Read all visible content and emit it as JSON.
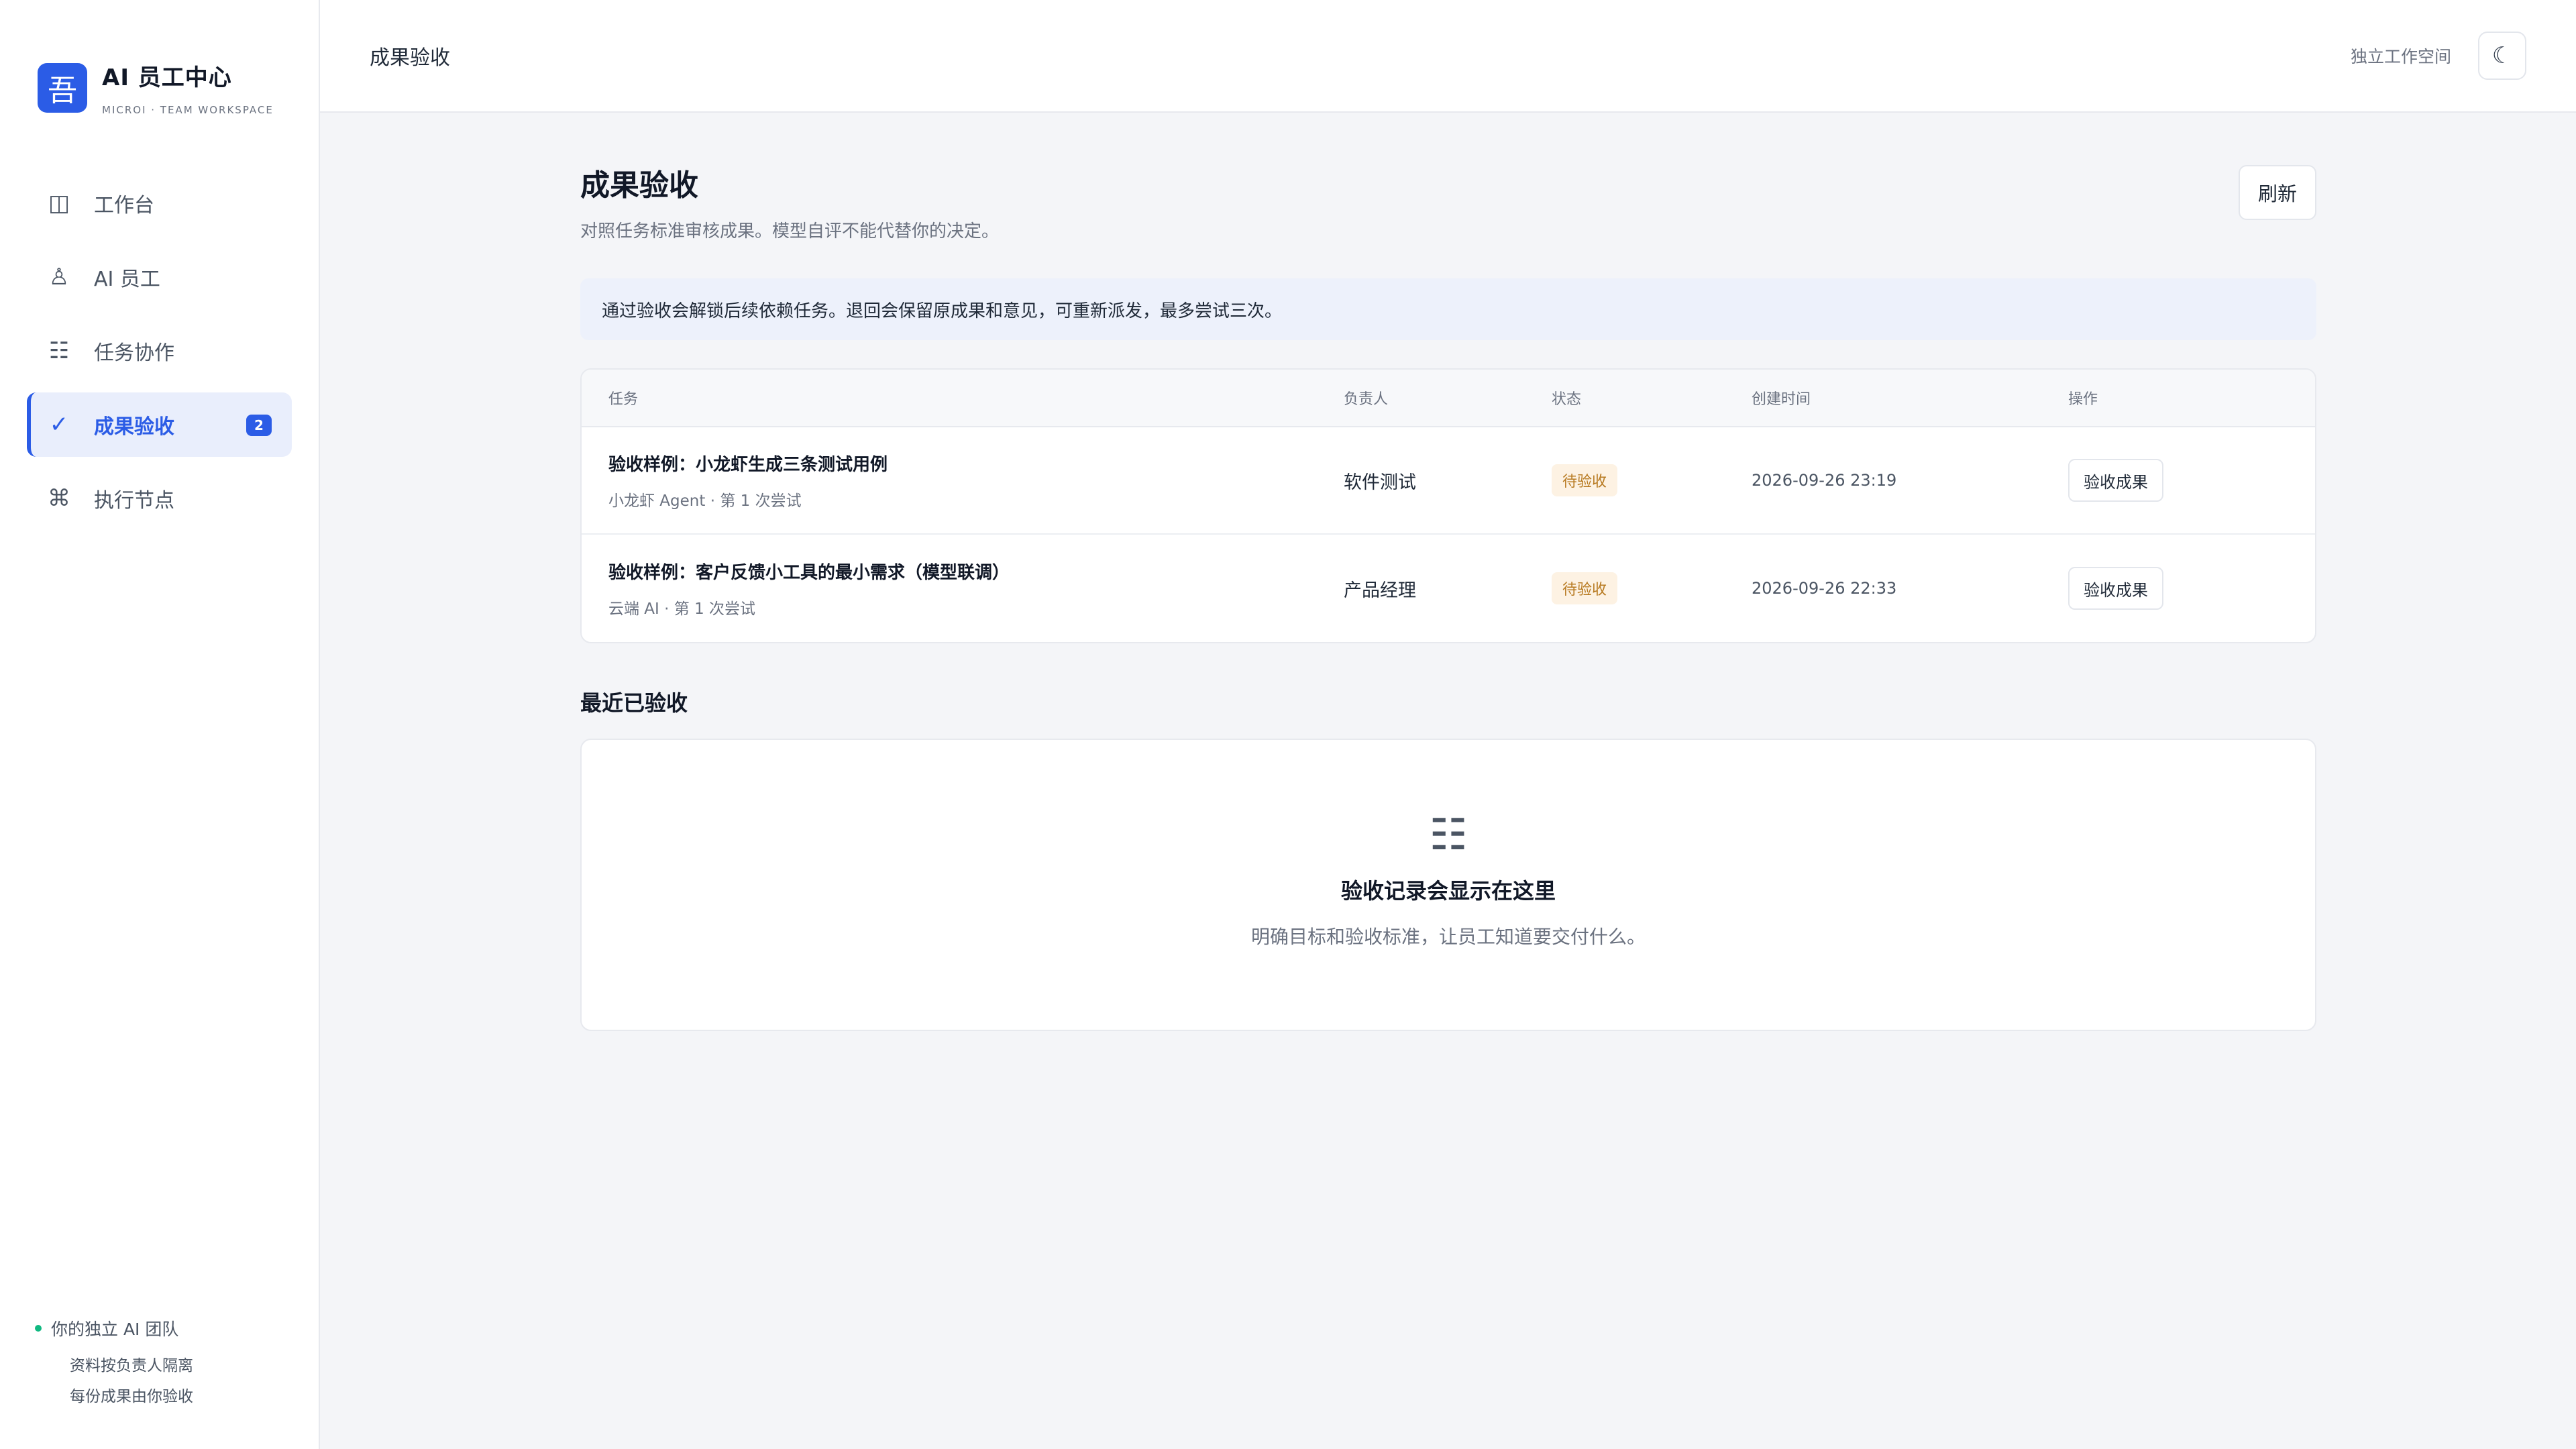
{
  "brand": {
    "logo_char": "吾",
    "title": "AI 员工中心",
    "subtitle": "MICROI · TEAM WORKSPACE"
  },
  "sidebar": {
    "items": [
      {
        "label": "工作台",
        "icon": "columns-icon",
        "glyph": "◫",
        "active": false
      },
      {
        "label": "AI 员工",
        "icon": "agent-icon",
        "glyph": "♙",
        "active": false
      },
      {
        "label": "任务协作",
        "icon": "list-icon",
        "glyph": "☷",
        "active": false
      },
      {
        "label": "成果验收",
        "icon": "check-icon",
        "glyph": "✓",
        "active": true,
        "badge": "2"
      },
      {
        "label": "执行节点",
        "icon": "command-icon",
        "glyph": "⌘",
        "active": false
      }
    ],
    "footer": {
      "status": "你的独立 AI 团队",
      "line1": "资料按负责人隔离",
      "line2": "每份成果由你验收"
    }
  },
  "topbar": {
    "title": "成果验收",
    "workspace": "独立工作空间",
    "theme_glyph": "☾"
  },
  "page": {
    "title": "成果验收",
    "description": "对照任务标准审核成果。模型自评不能代替你的决定。",
    "refresh_label": "刷新",
    "notice": "通过验收会解锁后续依赖任务。退回会保留原成果和意见，可重新派发，最多尝试三次。"
  },
  "table": {
    "headers": {
      "task": "任务",
      "owner": "负责人",
      "status": "状态",
      "created": "创建时间",
      "action": "操作"
    },
    "rows": [
      {
        "title": "验收样例：小龙虾生成三条测试用例",
        "meta": "小龙虾 Agent · 第 1 次尝试",
        "owner": "软件测试",
        "status": "待验收",
        "created": "2026-09-26 23:19",
        "action": "验收成果"
      },
      {
        "title": "验收样例：客户反馈小工具的最小需求（模型联调）",
        "meta": "云端 AI · 第 1 次尝试",
        "owner": "产品经理",
        "status": "待验收",
        "created": "2026-09-26 22:33",
        "action": "验收成果"
      }
    ]
  },
  "recent": {
    "title": "最近已验收",
    "empty_glyph": "☷",
    "empty_title": "验收记录会显示在这里",
    "empty_desc": "明确目标和验收标准，让员工知道要交付什么。"
  },
  "colors": {
    "accent": "#2b5ce6",
    "status_pending_bg": "#fdf2e3",
    "status_pending_fg": "#b7791f",
    "online": "#10b981"
  }
}
